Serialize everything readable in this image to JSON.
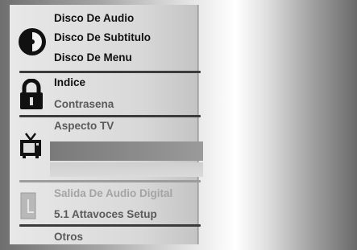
{
  "menu": {
    "disc": {
      "icon": "disc-icon",
      "items": [
        {
          "label": "Disco De Audio"
        },
        {
          "label": "Disco De Subtitulo"
        },
        {
          "label": "Disco De Menu"
        }
      ]
    },
    "lock": {
      "icon": "padlock-icon",
      "items": [
        {
          "label": "Indice"
        },
        {
          "label": "Contrasena"
        }
      ]
    },
    "tv": {
      "icon": "tv-icon",
      "items": [
        {
          "label": "Aspecto TV"
        }
      ]
    },
    "audio": {
      "icon": "speaker-icon",
      "items": [
        {
          "label": "Salida De Audio Digital"
        },
        {
          "label": "5.1 Attavoces Setup"
        }
      ]
    },
    "other": {
      "items": [
        {
          "label": "Otros"
        }
      ]
    }
  }
}
